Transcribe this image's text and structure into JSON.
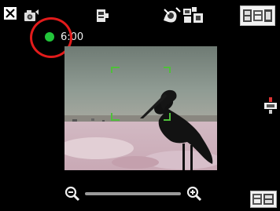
{
  "status_bar": {
    "timer_text": "6:00",
    "recording_dot_color": "#22c53a",
    "highlight_color": "#e21b1b"
  },
  "icons": {
    "close": "close-icon",
    "mode": "camera-mode-icon",
    "flash": "flash-icon",
    "white_balance": "white-balance-icon",
    "scene": "scene-mode-icon",
    "settings": "settings-badge",
    "zoom_out": "zoom-out-icon",
    "zoom_in": "zoom-in-icon",
    "menu": "menu-button"
  },
  "zoom": {
    "level": 0.0
  }
}
